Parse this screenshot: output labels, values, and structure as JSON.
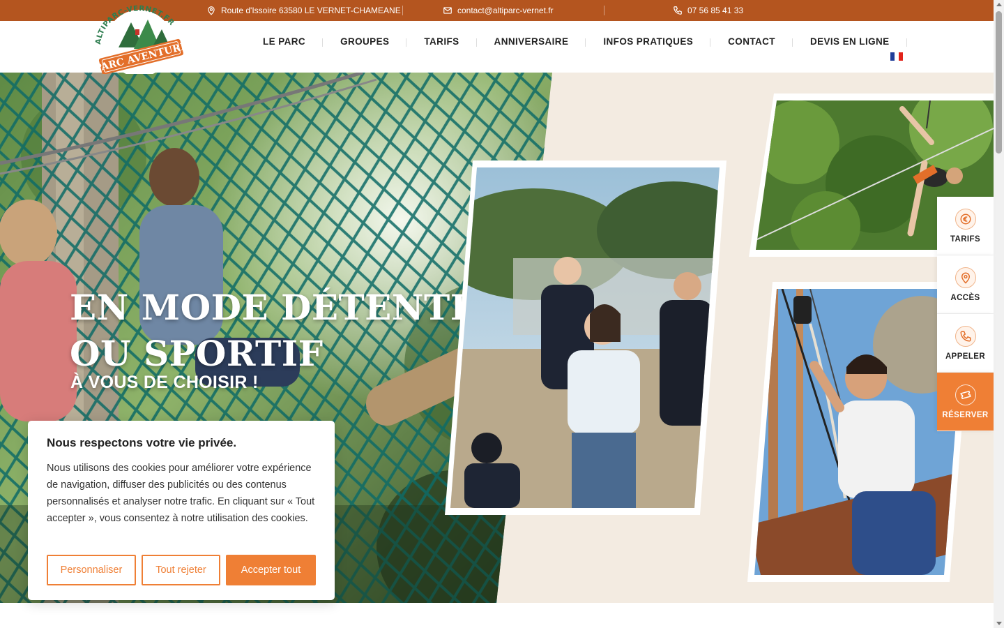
{
  "topbar": {
    "address": "Route d'Issoire 63580 LE VERNET-CHAMEANE",
    "email": "contact@altiparc-vernet.fr",
    "phone": "07 56 85 41 33"
  },
  "logo": {
    "arc_text": "ALTIPARC-VERNET.FR",
    "banner_text": "PARC AVENTURE"
  },
  "nav": {
    "items": [
      "LE PARC",
      "GROUPES",
      "TARIFS",
      "ANNIVERSAIRE",
      "INFOS PRATIQUES",
      "CONTACT",
      "DEVIS EN LIGNE"
    ],
    "language": "fr-flag"
  },
  "hero": {
    "title_line1": "EN MODE DÉTENTE",
    "title_line2": "OU SPORTIF",
    "subtitle": "À VOUS DE CHOISIR !"
  },
  "sidenav": {
    "items": [
      {
        "label": "TARIFS",
        "icon": "euro-icon"
      },
      {
        "label": "ACCÈS",
        "icon": "map-pin-icon"
      },
      {
        "label": "APPELER",
        "icon": "phone-icon"
      },
      {
        "label": "RÉSERVER",
        "icon": "ticket-icon"
      }
    ]
  },
  "cookie": {
    "title": "Nous respectons votre vie privée.",
    "text": "Nous utilisons des cookies pour améliorer votre expérience de navigation, diffuser des publicités ou des contenus personnalisés et analyser notre trafic. En cliquant sur « Tout accepter », vous consentez à notre utilisation des cookies.",
    "customize": "Personnaliser",
    "reject": "Tout rejeter",
    "accept": "Accepter tout"
  },
  "colors": {
    "topbar": "#b4551f",
    "accent": "#ef7f35",
    "hero_bg": "#f3ebe1"
  }
}
